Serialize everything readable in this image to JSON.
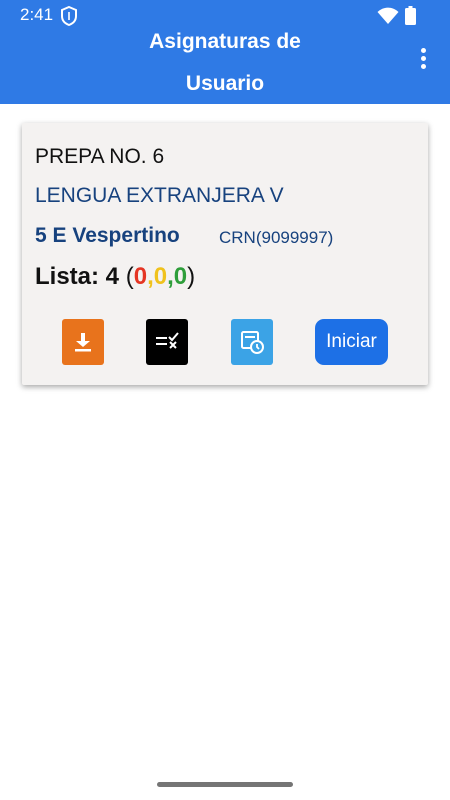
{
  "status_bar": {
    "time": "2:41",
    "icons": [
      "shield-icon",
      "wifi-icon",
      "battery-icon"
    ]
  },
  "app_bar": {
    "title_line1": "Asignaturas de",
    "title_line2": "Usuario",
    "color": "#2f7ae5",
    "menu_icon": "more-vert-icon"
  },
  "card": {
    "school": "PREPA NO. 6",
    "course": "LENGUA EXTRANJERA V",
    "group": "5 E Vespertino",
    "crn": "CRN(9099997)",
    "lista_label": "Lista: 4 ",
    "paren_open": "(",
    "count_red": "0",
    "comma1": ",",
    "count_yellow": "0",
    "comma2": ",",
    "count_green": "0",
    "paren_close": ")",
    "buttons": {
      "download_icon": "download-icon",
      "list_icon": "list-check-icon",
      "history_icon": "history-icon",
      "start_label": "Iniciar"
    },
    "colors": {
      "download": "#e8731c",
      "list": "#000000",
      "history": "#3ba3e6",
      "start": "#1d70e6"
    }
  }
}
